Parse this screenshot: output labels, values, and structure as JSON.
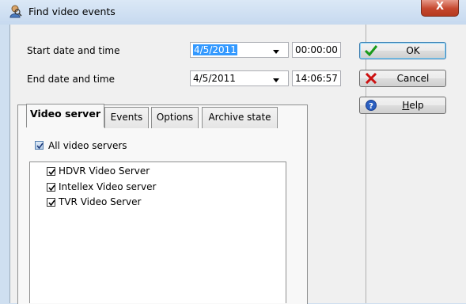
{
  "window": {
    "title": "Find video events",
    "close_label": "X"
  },
  "form": {
    "start_label": "Start date and time",
    "start_date": "4/5/2011",
    "start_time": "00:00:00",
    "end_label": "End date and time",
    "end_date": "4/5/2011",
    "end_time": "14:06:57"
  },
  "buttons": {
    "ok": "OK",
    "cancel": "Cancel",
    "help_underlined": "H",
    "help_rest": "elp"
  },
  "tabs": [
    {
      "label": "Video server",
      "active": true
    },
    {
      "label": "Events",
      "active": false
    },
    {
      "label": "Options",
      "active": false
    },
    {
      "label": "Archive state",
      "active": false
    }
  ],
  "video_server_tab": {
    "all_label": "All video servers",
    "all_checked": true,
    "servers": [
      {
        "label": "HDVR Video Server",
        "checked": true
      },
      {
        "label": "Intellex Video server",
        "checked": true
      },
      {
        "label": "TVR Video Server",
        "checked": true
      }
    ]
  },
  "icons": {
    "title": "find-people-icon",
    "ok": "checkmark-icon",
    "cancel": "red-x-icon",
    "help": "help-question-icon"
  },
  "colors": {
    "ok_check": "#1a9a1a",
    "cancel_x": "#cc1111",
    "help_blue": "#2a5fc0",
    "selection": "#3399ff"
  }
}
